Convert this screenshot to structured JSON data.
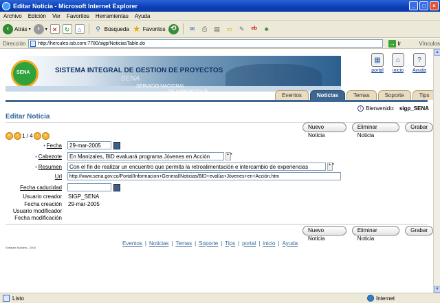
{
  "window": {
    "title": "Editar Noticia - Microsoft Internet Explorer",
    "buttons": [
      "_",
      "□",
      "×"
    ]
  },
  "menu": [
    "Archivo",
    "Edición",
    "Ver",
    "Favoritos",
    "Herramientas",
    "Ayuda"
  ],
  "toolbar": {
    "back_label": "Atrás",
    "search_label": "Búsqueda",
    "favorites_label": "Favoritos"
  },
  "address": {
    "label": "Dirección",
    "url": "http://hercules.isb.com:7780/sigp/NoticiasTable.do",
    "go_label": "Ir",
    "links_label": "Vínculos"
  },
  "banner": {
    "logo_text": "SENA",
    "title": "SISTEMA INTEGRAL DE GESTION DE PROYECTOS",
    "sena": "SENA",
    "sub1": "SERVICIO NACIONAL",
    "sub2": "DE APRENDIZAJE"
  },
  "global_links": [
    {
      "label": "portal",
      "icon": "portal-icon"
    },
    {
      "label": "inicio",
      "icon": "home-icon"
    },
    {
      "label": "Ayuda",
      "icon": "help-icon"
    }
  ],
  "tabs": [
    {
      "label": "Eventos",
      "active": false
    },
    {
      "label": "Noticias",
      "active": true
    },
    {
      "label": "Temas",
      "active": false
    },
    {
      "label": "Soporte",
      "active": false
    },
    {
      "label": "Tips",
      "active": false
    }
  ],
  "welcome": {
    "label": "Bienvenido:",
    "user": "sigp_SENA"
  },
  "page_title": "Editar Noticia",
  "buttons": {
    "nueva": "Nuevo Noticia",
    "eliminar": "Eliminar Noticia",
    "grabar": "Grabar"
  },
  "record_nav": {
    "text": "1 / 4"
  },
  "form": {
    "fecha": {
      "label": "Fecha",
      "value": "29-mar-2005"
    },
    "cabezote": {
      "label": "Cabezote",
      "value": "En Manizales, BID evaluará programa Jóvenes en Acción"
    },
    "resumen": {
      "label": "Resumen",
      "value": "Con el fin de realizar un encuentro que permita la retroalimentación e intercambio de experiencias"
    },
    "url": {
      "label": "Url",
      "value": "http://www.sena.gov.co/Portal/Informacion+General/Noticias/BID+evalúa+Jóvenes+en+Acción.htm"
    },
    "fecha_caducidad": {
      "label": "Fecha caducidad",
      "value": ""
    },
    "usuario_creador": {
      "label": "Usuario creador",
      "value": "SIGP_SENA"
    },
    "fecha_creacion": {
      "label": "Fecha creación",
      "value": "29-mar-2005"
    },
    "usuario_modificador": {
      "label": "Usuario modificador",
      "value": ""
    },
    "fecha_modificacion": {
      "label": "Fecha modificación",
      "value": ""
    }
  },
  "footer_links": [
    "Eventos",
    "Noticias",
    "Temas",
    "Soporte",
    "Tips",
    "portal",
    "inicio",
    "Ayuda"
  ],
  "footer_sep": "|",
  "copyright": "Software Builders - 2005",
  "status": {
    "text": "Listo",
    "zone": "Internet"
  }
}
